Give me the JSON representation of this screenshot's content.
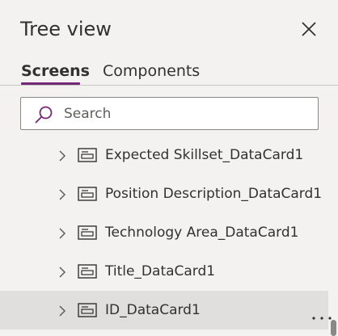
{
  "panel": {
    "title": "Tree view",
    "close_icon": "close-icon"
  },
  "tabs": [
    {
      "label": "Screens",
      "active": true
    },
    {
      "label": "Components",
      "active": false
    }
  ],
  "search": {
    "placeholder": "Search",
    "value": "",
    "icon": "search-icon"
  },
  "tree": {
    "items": [
      {
        "label": "Expected Skillset_DataCard1",
        "icon": "datacard-icon",
        "expand_icon": "chevron-right-icon"
      },
      {
        "label": "Position Description_DataCard1",
        "icon": "datacard-icon",
        "expand_icon": "chevron-right-icon"
      },
      {
        "label": "Technology Area_DataCard1",
        "icon": "datacard-icon",
        "expand_icon": "chevron-right-icon"
      },
      {
        "label": "Title_DataCard1",
        "icon": "datacard-icon",
        "expand_icon": "chevron-right-icon"
      },
      {
        "label": "ID_DataCard1",
        "icon": "datacard-icon",
        "expand_icon": "chevron-right-icon",
        "selected": true,
        "more_icon": "more-options-icon"
      }
    ]
  },
  "colors": {
    "accent": "#742774",
    "background": "#f3f2f1",
    "selected_row": "#e1dfdd",
    "text": "#323130"
  }
}
